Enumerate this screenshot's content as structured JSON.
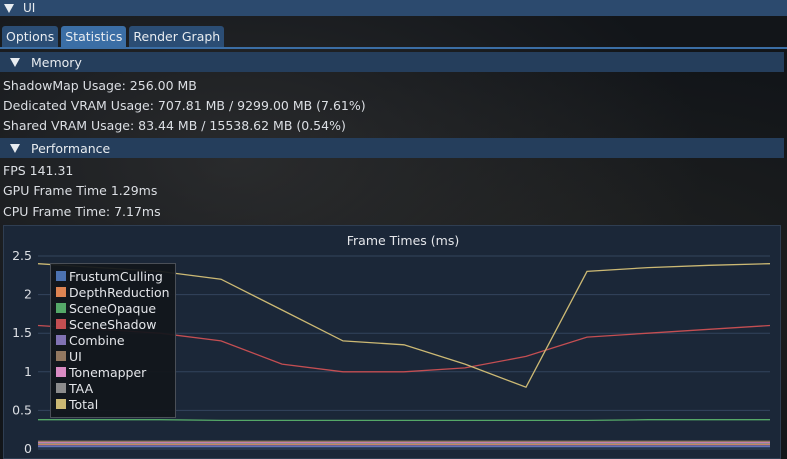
{
  "window": {
    "title": "UI"
  },
  "tabs": [
    {
      "label": "Options",
      "active": false
    },
    {
      "label": "Statistics",
      "active": true
    },
    {
      "label": "Render Graph",
      "active": false
    }
  ],
  "memory": {
    "header": "Memory",
    "shadowmap": "ShadowMap Usage: 256.00 MB",
    "dedicated": "Dedicated VRAM Usage: 707.81 MB / 9299.00 MB (7.61%)",
    "shared": "Shared VRAM Usage: 83.44 MB / 15538.62 MB (0.54%)"
  },
  "performance": {
    "header": "Performance",
    "fps": "FPS 141.31",
    "gpu": "GPU Frame Time 1.29ms",
    "cpu": "CPU Frame Time: 7.17ms"
  },
  "colors": {
    "accent": "#3b6ea5",
    "header": "#253e5c",
    "title_bar": "#2c4a6e"
  },
  "chart_data": {
    "type": "line",
    "title": "Frame Times (ms)",
    "xlabel": "",
    "ylabel": "",
    "ylim": [
      0,
      2.5
    ],
    "y_ticks": [
      "2.5",
      "2",
      "1.5",
      "1",
      "0.5",
      "0"
    ],
    "legend_position": "top-left",
    "grid": true,
    "series": [
      {
        "name": "FrustumCulling",
        "color": "#4c72b0",
        "values": [
          0.03,
          0.03,
          0.03,
          0.03,
          0.03,
          0.03,
          0.03,
          0.03,
          0.03,
          0.03,
          0.03,
          0.03,
          0.03
        ]
      },
      {
        "name": "DepthReduction",
        "color": "#dd8452",
        "values": [
          0.06,
          0.06,
          0.06,
          0.06,
          0.06,
          0.06,
          0.06,
          0.06,
          0.06,
          0.06,
          0.06,
          0.06,
          0.06
        ]
      },
      {
        "name": "SceneOpaque",
        "color": "#55a868",
        "values": [
          0.38,
          0.38,
          0.38,
          0.37,
          0.37,
          0.37,
          0.37,
          0.37,
          0.37,
          0.37,
          0.38,
          0.38,
          0.38
        ]
      },
      {
        "name": "SceneShadow",
        "color": "#c44e52",
        "values": [
          1.6,
          1.55,
          1.5,
          1.4,
          1.1,
          1.0,
          1.0,
          1.05,
          1.2,
          1.45,
          1.5,
          1.55,
          1.6
        ]
      },
      {
        "name": "Combine",
        "color": "#8172b3",
        "values": [
          0.04,
          0.04,
          0.04,
          0.04,
          0.04,
          0.04,
          0.04,
          0.04,
          0.04,
          0.04,
          0.04,
          0.04,
          0.04
        ]
      },
      {
        "name": "UI",
        "color": "#937860",
        "values": [
          0.1,
          0.1,
          0.1,
          0.1,
          0.1,
          0.1,
          0.1,
          0.1,
          0.1,
          0.1,
          0.1,
          0.1,
          0.1
        ]
      },
      {
        "name": "Tonemapper",
        "color": "#da8bc3",
        "values": [
          0.08,
          0.08,
          0.08,
          0.08,
          0.08,
          0.08,
          0.08,
          0.08,
          0.08,
          0.08,
          0.08,
          0.08,
          0.08
        ]
      },
      {
        "name": "TAA",
        "color": "#8c8c8c",
        "values": [
          0.07,
          0.07,
          0.07,
          0.07,
          0.07,
          0.07,
          0.07,
          0.07,
          0.07,
          0.07,
          0.07,
          0.07,
          0.07
        ]
      },
      {
        "name": "Total",
        "color": "#ccb974",
        "values": [
          2.4,
          2.35,
          2.3,
          2.2,
          1.8,
          1.4,
          1.35,
          1.1,
          0.8,
          2.3,
          2.35,
          2.38,
          2.4
        ]
      }
    ]
  }
}
